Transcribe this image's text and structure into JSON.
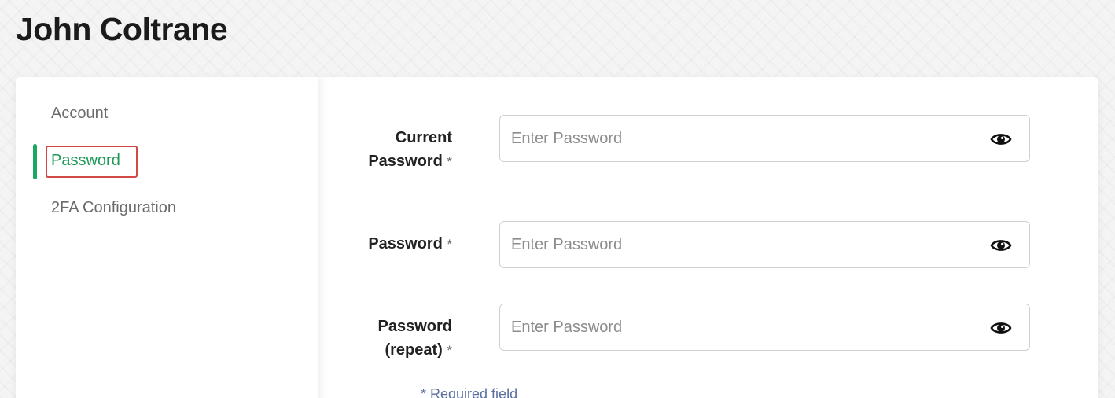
{
  "page": {
    "title": "John Coltrane"
  },
  "sidebar": {
    "items": [
      {
        "label": "Account",
        "active": false
      },
      {
        "label": "Password",
        "active": true
      },
      {
        "label": "2FA Configuration",
        "active": false
      }
    ]
  },
  "form": {
    "fields": [
      {
        "label_line1": "Current",
        "label_line2": "Password",
        "required_mark": "*",
        "placeholder": "Enter Password",
        "value": ""
      },
      {
        "label_line1": "Password",
        "required_mark": "*",
        "placeholder": "Enter Password",
        "value": ""
      },
      {
        "label_line1": "Password",
        "label_line2": "(repeat)",
        "required_mark": "*",
        "placeholder": "Enter Password",
        "value": ""
      }
    ],
    "required_note": "* Required field"
  },
  "icons": {
    "password_toggle": "eye-icon"
  },
  "colors": {
    "accent_green": "#18a862",
    "active_text": "#1f9a57",
    "focus_outline": "#d04848"
  }
}
